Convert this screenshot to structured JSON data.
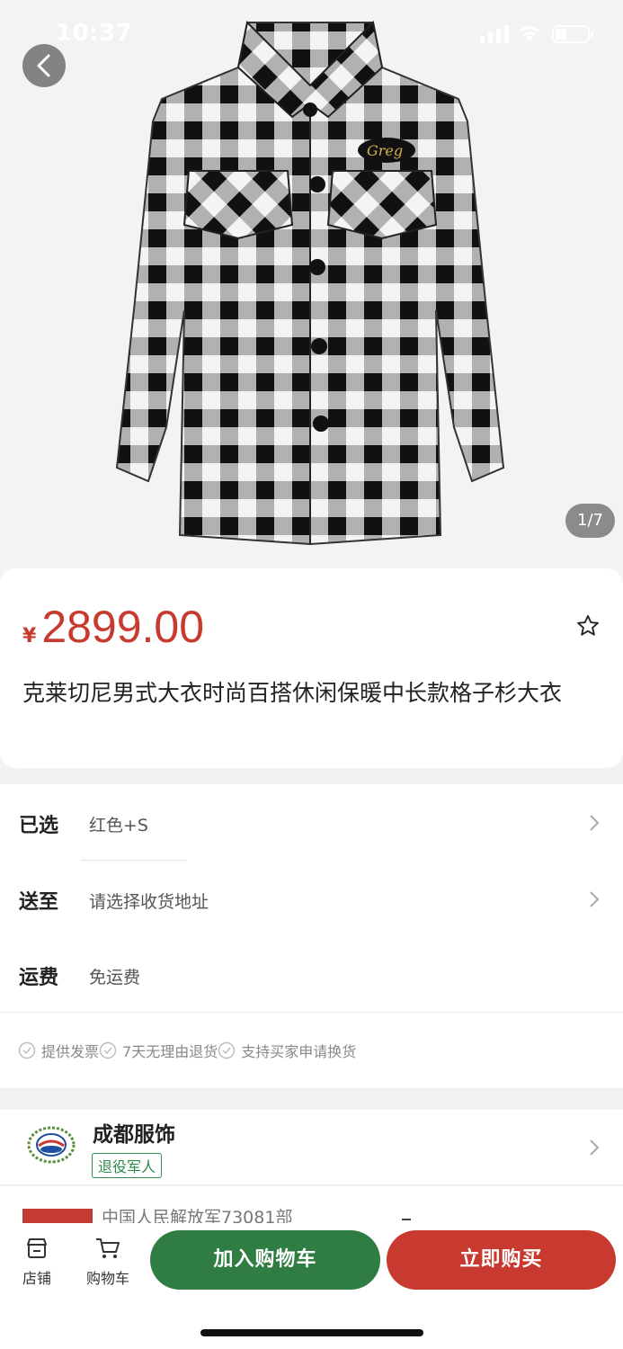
{
  "status_bar": {
    "time": "10:37"
  },
  "gallery": {
    "counter": "1/7"
  },
  "product": {
    "currency": "¥",
    "price": "2899.00",
    "title": "克莱切尼男式大衣时尚百搭休闲保暖中长款格子杉大衣"
  },
  "specs": {
    "selected_label": "已选",
    "selected_value": "红色+S",
    "ship_to_label": "送至",
    "ship_to_value": "请选择收货地址",
    "freight_label": "运费",
    "freight_value": "免运费"
  },
  "guarantees": [
    "提供发票",
    "7天无理由退货",
    "支持买家申请换货"
  ],
  "shop": {
    "name": "成都服饰",
    "badge": "退役军人"
  },
  "partial_row": {
    "text": "中国人民解放军73081部"
  },
  "bottom_bar": {
    "store_label": "店铺",
    "cart_label": "购物车",
    "add_to_cart": "加入购物车",
    "buy_now": "立即购买"
  },
  "colors": {
    "accent_red": "#c83a2f",
    "accent_green": "#2f7d43"
  }
}
